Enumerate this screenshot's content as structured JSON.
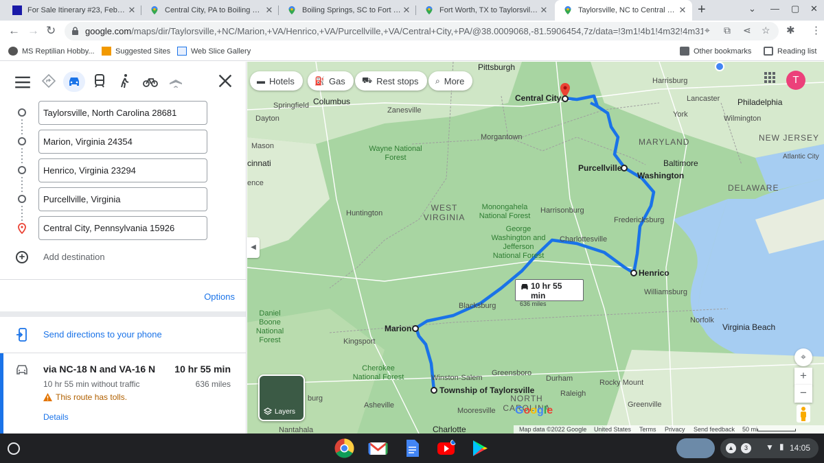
{
  "browser": {
    "tabs": [
      {
        "title": "For Sale Itinerary #23, February",
        "favicon": "blue-square-icon",
        "active": false
      },
      {
        "title": "Central City, PA to Boiling Sprin",
        "favicon": "maps-pin-icon",
        "active": false
      },
      {
        "title": "Boiling Springs, SC to Fort Wor",
        "favicon": "maps-pin-icon",
        "active": false
      },
      {
        "title": "Fort Worth, TX to Taylorsville, N",
        "favicon": "maps-pin-icon",
        "active": false
      },
      {
        "title": "Taylorsville, NC to Central City,",
        "favicon": "maps-pin-icon",
        "active": true
      }
    ],
    "url_host": "google.com",
    "url_path": "/maps/dir/Taylorsville,+NC/Marion,+VA/Henrico,+VA/Purcellville,+VA/Central+City,+PA/@38.0009068,-81.5906454,7z/data=!3m1!4b1!4m32!4m31!1...",
    "bookmarks": [
      {
        "label": "MS Reptilian Hobby...",
        "icon": "reptile-icon"
      },
      {
        "label": "Suggested Sites",
        "icon": "suggested-icon"
      },
      {
        "label": "Web Slice Gallery",
        "icon": "web-slice-icon"
      }
    ],
    "other_bookmarks": "Other bookmarks",
    "reading_list": "Reading list"
  },
  "directions": {
    "waypoints": [
      "Taylorsville, North Carolina 28681",
      "Marion, Virginia 24354",
      "Henrico, Virginia 23294",
      "Purcellville, Virginia",
      "Central City, Pennsylvania 15926"
    ],
    "add_destination": "Add destination",
    "options": "Options",
    "send_to_phone": "Send directions to your phone",
    "route": {
      "title": "via NC-18 N and VA-16 N",
      "time": "10 hr 55 min",
      "subtitle": "10 hr 55 min without traffic",
      "distance": "636 miles",
      "toll_warning": "This route has tolls.",
      "details": "Details"
    }
  },
  "map": {
    "chips": [
      {
        "label": "Hotels",
        "icon": "bed-icon"
      },
      {
        "label": "Gas",
        "icon": "gas-icon"
      },
      {
        "label": "Rest stops",
        "icon": "rest-stop-icon"
      },
      {
        "label": "More",
        "icon": "search-icon"
      }
    ],
    "route_callout": {
      "time": "10 hr 55 min",
      "distance": "636 miles"
    },
    "avatar_initial": "T",
    "layers_label": "Layers",
    "attribution": {
      "data": "Map data ©2022 Google",
      "country": "United States",
      "terms": "Terms",
      "privacy": "Privacy",
      "feedback": "Send feedback",
      "scale": "50 mi"
    },
    "labels": {
      "pittsburgh": "Pittsburgh",
      "harrisburg": "Harrisburg",
      "columbus": "Columbus",
      "springfield": "Springfield",
      "zanesville": "Zanesville",
      "dayton": "Dayton",
      "lancaster": "Lancaster",
      "philadelphia": "Philadelphia",
      "york": "York",
      "wilmington": "Wilmington",
      "new_jersey": "NEW JERSEY",
      "atlantic_city": "Atlantic City",
      "maryland": "MARYLAND",
      "baltimore": "Baltimore",
      "washington": "Washington",
      "delaware": "DELAWARE",
      "mason": "Mason",
      "cincinnati": "cinnati",
      "ence": "ence",
      "morgantown": "Morgantown",
      "wayne_nf": "Wayne National Forest",
      "west_virginia": "WEST VIRGINIA",
      "huntington": "Huntington",
      "monongahela": "Monongahela National Forest",
      "harrisonburg": "Harrisonburg",
      "fredericksburg": "Fredericksburg",
      "on": "on",
      "charlottesville": "Charlottesville",
      "gw_nf": "George Washington and Jefferson National Forest",
      "williamsburg": "Williamsburg",
      "blacksburg": "Blacksburg",
      "daniel_boone": "Daniel Boone National Forest",
      "norfolk": "Norfolk",
      "virginia_beach": "Virginia Beach",
      "kingsport": "Kingsport",
      "winston_salem": "Winston-Salem",
      "greensboro": "Greensboro",
      "durham": "Durham",
      "rocky_mount": "Rocky Mount",
      "cherokee_nf": "Cherokee National Forest",
      "raleigh": "Raleigh",
      "north_carolina": "NORTH CAROLINA",
      "greenville": "Greenville",
      "asheville": "Asheville",
      "mooresville": "Mooresville",
      "charlotte": "Charlotte",
      "nantahala": "Nantahala",
      "burg": "burg"
    },
    "markers": {
      "central_city": "Central City",
      "purcellville": "Purcellville",
      "henrico": "Henrico",
      "marion": "Marion",
      "taylorsville": "Township of Taylorsville"
    }
  },
  "shelf": {
    "apps": [
      "chrome-icon",
      "gmail-icon",
      "docs-icon",
      "youtube-icon",
      "play-store-icon"
    ],
    "notifications": "3",
    "time": "14:05"
  }
}
